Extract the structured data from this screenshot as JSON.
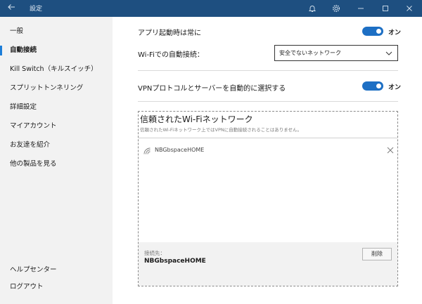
{
  "window": {
    "title": "設定",
    "back_icon": "back-arrow-icon",
    "icons": [
      "bell-icon",
      "gear-icon",
      "minimize-icon",
      "maximize-icon",
      "close-icon"
    ]
  },
  "sidebar": {
    "items": [
      {
        "label": "一般",
        "active": false
      },
      {
        "label": "自動接続",
        "active": true
      },
      {
        "label": "Kill Switch（キルスイッチ）",
        "active": false
      },
      {
        "label": "スプリットトンネリング",
        "active": false
      },
      {
        "label": "詳細設定",
        "active": false
      },
      {
        "label": "マイアカウント",
        "active": false
      },
      {
        "label": "お友達を紹介",
        "active": false
      },
      {
        "label": "他の製品を見る",
        "active": false
      }
    ],
    "bottom": [
      {
        "label": "ヘルプセンター"
      },
      {
        "label": "ログアウト"
      }
    ]
  },
  "settings": {
    "app_launch": {
      "label": "アプリ起動時は常に",
      "toggle_label": "オン",
      "on": true
    },
    "wifi_auto": {
      "label": "Wi-Fiでの自動接続：",
      "selected": "安全でないネットワーク"
    },
    "vpn_protocol": {
      "label": "VPNプロトコルとサーバーを自動的に選択する",
      "toggle_label": "オン",
      "on": true
    }
  },
  "trusted": {
    "title": "信頼されたWi-Fiネットワーク",
    "subtitle": "信頼されたWi-Fiネットワーク上ではVPNに自動接続されることはありません。",
    "networks": [
      {
        "name": "NBGbspaceHOME"
      }
    ],
    "footer_label": "接続先：",
    "footer_value": "NBGbspaceHOME",
    "delete_label": "削除"
  },
  "colors": {
    "titlebar": "#1e4f80",
    "accent": "#1d6fc4",
    "sidebar_bg": "#f2f2f2"
  }
}
